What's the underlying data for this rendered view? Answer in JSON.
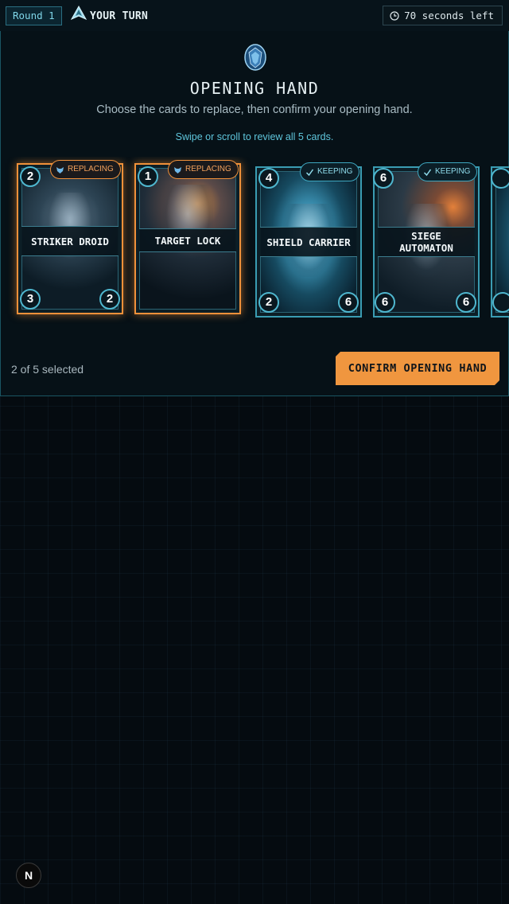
{
  "topbar": {
    "round_label": "Round 1",
    "turn_label": "YOUR TURN",
    "timer_text": "70 seconds left",
    "icons": {
      "turn": "pyramid-ship-icon",
      "timer": "clock-icon"
    }
  },
  "panel": {
    "title": "OPENING HAND",
    "subtitle": "Choose the cards to replace, then confirm your opening hand.",
    "hint": "Swipe or scroll to review all 5 cards.",
    "selected_count": "2 of 5 selected",
    "confirm_label": "CONFIRM OPENING HAND",
    "emblem_icon": "crystal-emblem-icon"
  },
  "cards": [
    {
      "name": "STRIKER DROID",
      "cost": "2",
      "attack": "3",
      "health": "2",
      "status": "REPLACING",
      "has_stats": true
    },
    {
      "name": "TARGET LOCK",
      "cost": "1",
      "attack": "",
      "health": "",
      "status": "REPLACING",
      "has_stats": false
    },
    {
      "name": "SHIELD CARRIER",
      "cost": "4",
      "attack": "2",
      "health": "6",
      "status": "KEEPING",
      "has_stats": true
    },
    {
      "name": "SIEGE AUTOMATON",
      "cost": "6",
      "attack": "6",
      "health": "6",
      "status": "KEEPING",
      "has_stats": true
    }
  ],
  "corner_button": {
    "label": "N"
  },
  "colors": {
    "accent": "#f0963f",
    "cyan": "#3ea7c0",
    "background": "#050b10"
  }
}
